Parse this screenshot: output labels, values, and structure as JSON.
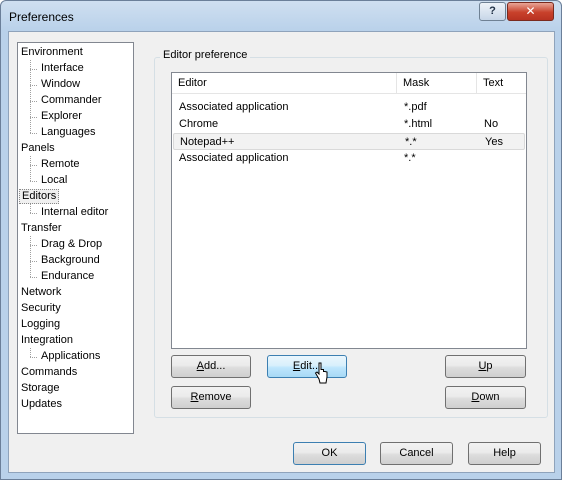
{
  "window": {
    "title": "Preferences",
    "help_glyph": "?",
    "close_glyph": "✕"
  },
  "tree": {
    "items": [
      {
        "label": "Environment",
        "level": 0
      },
      {
        "label": "Interface",
        "level": 1
      },
      {
        "label": "Window",
        "level": 1
      },
      {
        "label": "Commander",
        "level": 1
      },
      {
        "label": "Explorer",
        "level": 1
      },
      {
        "label": "Languages",
        "level": 1
      },
      {
        "label": "Panels",
        "level": 0
      },
      {
        "label": "Remote",
        "level": 1
      },
      {
        "label": "Local",
        "level": 1
      },
      {
        "label": "Editors",
        "level": 0,
        "selected": true
      },
      {
        "label": "Internal editor",
        "level": 1
      },
      {
        "label": "Transfer",
        "level": 0
      },
      {
        "label": "Drag & Drop",
        "level": 1
      },
      {
        "label": "Background",
        "level": 1
      },
      {
        "label": "Endurance",
        "level": 1
      },
      {
        "label": "Network",
        "level": 0
      },
      {
        "label": "Security",
        "level": 0
      },
      {
        "label": "Logging",
        "level": 0
      },
      {
        "label": "Integration",
        "level": 0
      },
      {
        "label": "Applications",
        "level": 1
      },
      {
        "label": "Commands",
        "level": 0
      },
      {
        "label": "Storage",
        "level": 0
      },
      {
        "label": "Updates",
        "level": 0
      }
    ]
  },
  "editor_group": {
    "label": "Editor preference"
  },
  "table": {
    "columns": [
      "Editor",
      "Mask",
      "Text"
    ],
    "rows": [
      [
        "Associated application",
        "*.pdf",
        ""
      ],
      [
        "Chrome",
        "*.html",
        "No"
      ],
      [
        "Notepad++",
        "*.*",
        "Yes"
      ],
      [
        "Associated application",
        "*.*",
        ""
      ]
    ],
    "selected_row": 2
  },
  "buttons": {
    "add": "Add...",
    "edit": "Edit...",
    "up": "Up",
    "remove": "Remove",
    "down": "Down",
    "ok": "OK",
    "cancel": "Cancel",
    "help": "Help"
  }
}
